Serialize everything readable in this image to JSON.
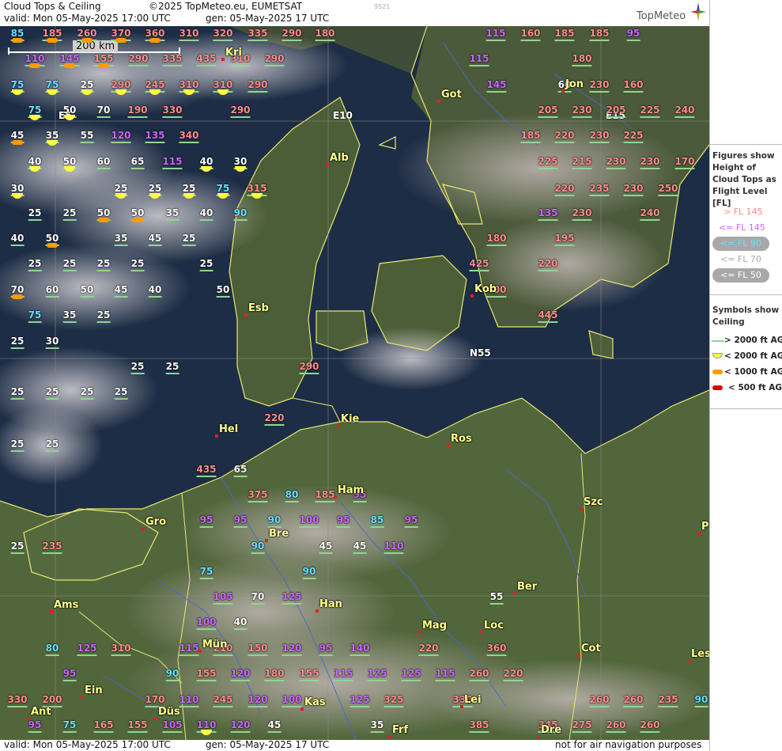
{
  "header": {
    "title": "Cloud Tops & Ceiling",
    "copyright": "©2025 TopMeteo.eu, EUMETSAT",
    "valid": "valid:  Mon  05-May-2025  17:00 UTC",
    "generated": "gen: 05-May-2025 17 UTC",
    "image_code": "9521",
    "brand": "TopMeteo"
  },
  "footer": {
    "valid": "valid:  Mon  05-May-2025  17:00 UTC",
    "generated": "gen: 05-May-2025 17 UTC",
    "disclaimer": "not for air navigation purposes"
  },
  "legend": {
    "figures_title": "Figures show Height of Cloud Tops as Flight Level  [FL]",
    "fl_items": [
      {
        "label": "> FL 145",
        "color": "#ff8c8c"
      },
      {
        "label": "<= FL 145",
        "color": "#cc66ff"
      },
      {
        "label": "<= FL 90",
        "color": "#66e0ff"
      },
      {
        "label": "<= FL 70",
        "color": "#ffffff"
      },
      {
        "label": "<= FL 50",
        "color": "#ffffff"
      }
    ],
    "symbols_title": "Symbols show Ceiling",
    "ceiling_items": [
      {
        "label": "> 2000 ft AGL",
        "color": "#8fd68f"
      },
      {
        "label": "< 2000 ft AGL",
        "color": "#ffff40"
      },
      {
        "label": "< 1000 ft AGL",
        "color": "#ff9a00"
      },
      {
        "label": "< 500 ft AGL",
        "color": "#e00000"
      }
    ]
  },
  "map": {
    "scale_label": "200 km",
    "grid_labels": [
      "E5",
      "E10",
      "E15",
      "N55"
    ],
    "cities": [
      "Kri",
      "Got",
      "Jon",
      "Alb",
      "Esb",
      "Kob",
      "Kie",
      "Hel",
      "Ros",
      "Ham",
      "Gro",
      "Bre",
      "Szc",
      "Ams",
      "Han",
      "Ber",
      "Mag",
      "Loc",
      "Mün",
      "Cot",
      "Les",
      "Ein",
      "Kas",
      "Lei",
      "Ant",
      "Düs",
      "Frf",
      "Dre",
      "P"
    ],
    "flight_levels": [
      "85",
      "185",
      "260",
      "370",
      "360",
      "310",
      "320",
      "335",
      "290",
      "180",
      "115",
      "160",
      "185",
      "185",
      "95",
      "110",
      "145",
      "155",
      "290",
      "335",
      "435",
      "310",
      "290",
      "115",
      "180",
      "75",
      "75",
      "25",
      "290",
      "245",
      "310",
      "310",
      "290",
      "145",
      "60",
      "230",
      "160",
      "75",
      "50",
      "70",
      "190",
      "330",
      "290",
      "205",
      "230",
      "205",
      "225",
      "240",
      "45",
      "35",
      "55",
      "120",
      "135",
      "340",
      "185",
      "220",
      "230",
      "225",
      "40",
      "50",
      "60",
      "65",
      "115",
      "40",
      "30",
      "225",
      "215",
      "230",
      "230",
      "170",
      "30",
      "25",
      "25",
      "25",
      "75",
      "315",
      "220",
      "235",
      "230",
      "250",
      "25",
      "25",
      "50",
      "50",
      "35",
      "40",
      "90",
      "135",
      "230",
      "240",
      "40",
      "50",
      "35",
      "45",
      "25",
      "180",
      "195",
      "25",
      "25",
      "25",
      "25",
      "25",
      "425",
      "220",
      "70",
      "60",
      "50",
      "45",
      "40",
      "50",
      "400",
      "75",
      "35",
      "25",
      "445",
      "25",
      "30",
      "25",
      "25",
      "290",
      "25",
      "25",
      "25",
      "25",
      "220",
      "25",
      "25",
      "435",
      "65",
      "375",
      "80",
      "185",
      "95",
      "95",
      "95",
      "90",
      "100",
      "95",
      "85",
      "95",
      "25",
      "235",
      "90",
      "45",
      "45",
      "110",
      "75",
      "90",
      "105",
      "70",
      "125",
      "55",
      "100",
      "40",
      "80",
      "125",
      "310",
      "115",
      "210",
      "150",
      "120",
      "95",
      "140",
      "220",
      "360",
      "95",
      "90",
      "155",
      "120",
      "180",
      "155",
      "115",
      "125",
      "125",
      "115",
      "260",
      "220",
      "330",
      "200",
      "170",
      "110",
      "245",
      "120",
      "100",
      "125",
      "325",
      "330",
      "260",
      "260",
      "235",
      "90",
      "95",
      "75",
      "165",
      "155",
      "105",
      "110",
      "120",
      "45",
      "35",
      "385",
      "345",
      "275",
      "260",
      "260"
    ]
  }
}
